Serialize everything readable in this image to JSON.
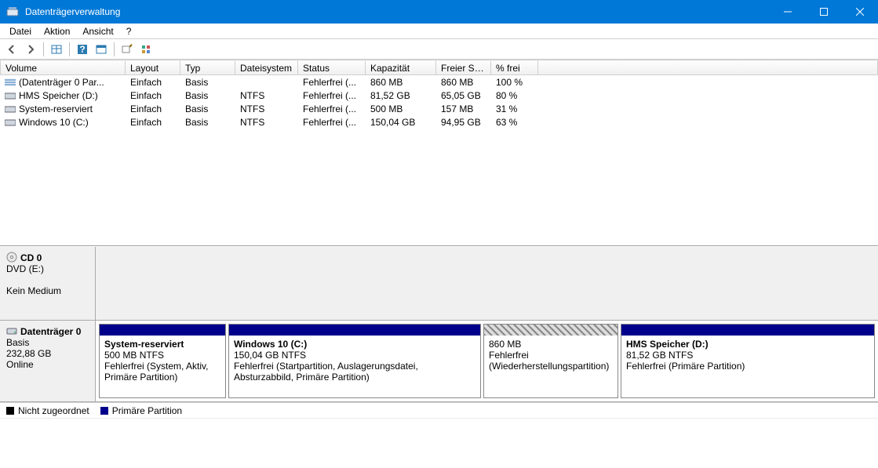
{
  "window": {
    "title": "Datenträgerverwaltung"
  },
  "menu": {
    "file": "Datei",
    "action": "Aktion",
    "view": "Ansicht",
    "help": "?"
  },
  "columns": {
    "volume": "Volume",
    "layout": "Layout",
    "type": "Typ",
    "fs": "Dateisystem",
    "status": "Status",
    "capacity": "Kapazität",
    "free": "Freier Sp...",
    "pct": "% frei"
  },
  "volumes": [
    {
      "icon": "stripes",
      "name": "(Datenträger 0 Par...",
      "layout": "Einfach",
      "type": "Basis",
      "fs": "",
      "status": "Fehlerfrei (...",
      "cap": "860 MB",
      "free": "860 MB",
      "pct": "100 %"
    },
    {
      "icon": "drive",
      "name": "HMS Speicher (D:)",
      "layout": "Einfach",
      "type": "Basis",
      "fs": "NTFS",
      "status": "Fehlerfrei (...",
      "cap": "81,52 GB",
      "free": "65,05 GB",
      "pct": "80 %"
    },
    {
      "icon": "drive",
      "name": "System-reserviert",
      "layout": "Einfach",
      "type": "Basis",
      "fs": "NTFS",
      "status": "Fehlerfrei (...",
      "cap": "500 MB",
      "free": "157 MB",
      "pct": "31 %"
    },
    {
      "icon": "drive",
      "name": "Windows 10 (C:)",
      "layout": "Einfach",
      "type": "Basis",
      "fs": "NTFS",
      "status": "Fehlerfrei (...",
      "cap": "150,04 GB",
      "free": "94,95 GB",
      "pct": "63 %"
    }
  ],
  "cd": {
    "header": "CD 0",
    "line1": "DVD (E:)",
    "line2": "Kein Medium"
  },
  "disk0": {
    "header": "Datenträger 0",
    "type": "Basis",
    "size": "232,88 GB",
    "state": "Online",
    "parts": [
      {
        "title": "System-reserviert",
        "sub": "500 MB NTFS",
        "status": "Fehlerfrei (System, Aktiv, Primäre Partition)",
        "stripe": "blue",
        "w": "pw1"
      },
      {
        "title": "Windows 10  (C:)",
        "sub": "150,04 GB NTFS",
        "status": "Fehlerfrei (Startpartition, Auslagerungsdatei, Absturzabbild, Primäre Partition)",
        "stripe": "blue",
        "w": "pw2"
      },
      {
        "title": "",
        "sub": "860 MB",
        "status": "Fehlerfrei (Wiederherstellungspartition)",
        "stripe": "hatch",
        "w": "pw3"
      },
      {
        "title": "HMS Speicher  (D:)",
        "sub": "81,52 GB NTFS",
        "status": "Fehlerfrei (Primäre Partition)",
        "stripe": "blue",
        "w": "pw4"
      }
    ]
  },
  "legend": {
    "unalloc": "Nicht zugeordnet",
    "primary": "Primäre Partition"
  }
}
